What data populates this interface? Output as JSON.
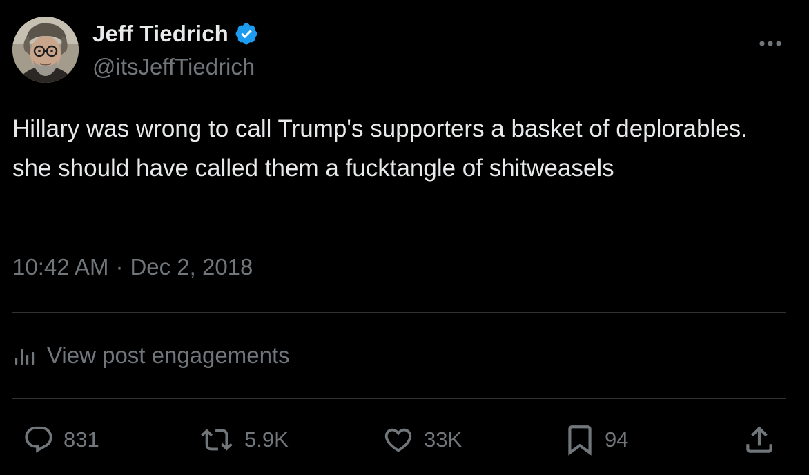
{
  "author": {
    "display_name": "Jeff Tiedrich",
    "handle": "@itsJeffTiedrich",
    "verified": true
  },
  "tweet": {
    "text": "Hillary was wrong to call Trump's supporters a basket of deplorables. she should have called them a fucktangle of shitweasels",
    "time": "10:42 AM",
    "separator": "·",
    "date": "Dec 2, 2018"
  },
  "engagements": {
    "label": "View post engagements",
    "icon": "analytics-bars-icon"
  },
  "actions": {
    "reply": {
      "icon": "reply-bubble-icon",
      "count": "831"
    },
    "retweet": {
      "icon": "retweet-icon",
      "count": "5.9K"
    },
    "like": {
      "icon": "heart-icon",
      "count": "33K"
    },
    "bookmark": {
      "icon": "bookmark-icon",
      "count": "94"
    },
    "share": {
      "icon": "share-upload-icon"
    }
  },
  "colors": {
    "background": "#000000",
    "primary_text": "#e7e9ea",
    "secondary_text": "#71767b",
    "divider": "#2f3336",
    "verified_badge": "#1d9bf0"
  }
}
